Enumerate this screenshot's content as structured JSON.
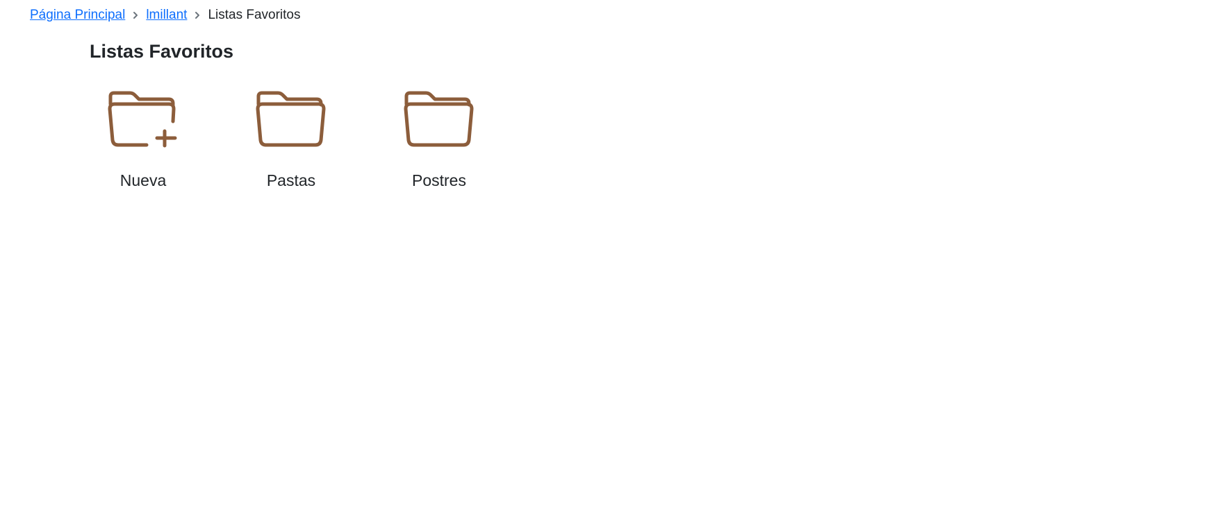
{
  "breadcrumb": {
    "items": [
      {
        "label": "Página Principal"
      },
      {
        "label": "lmillant"
      }
    ],
    "current": "Listas Favoritos"
  },
  "page": {
    "title": "Listas Favoritos"
  },
  "folders": [
    {
      "label": "Nueva",
      "icon": "folder-plus-icon"
    },
    {
      "label": "Pastas",
      "icon": "folder-icon"
    },
    {
      "label": "Postres",
      "icon": "folder-icon"
    }
  ],
  "colors": {
    "link": "#0d6efd",
    "folder": "#8c5d3b",
    "text": "#212529"
  }
}
